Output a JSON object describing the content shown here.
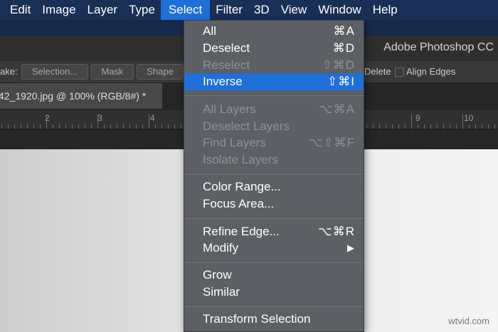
{
  "menubar": {
    "items": [
      "Edit",
      "Image",
      "Layer",
      "Type",
      "Select",
      "Filter",
      "3D",
      "View",
      "Window",
      "Help"
    ],
    "active": "Select"
  },
  "app": {
    "title": "Adobe Photoshop CC"
  },
  "options_bar": {
    "make_label": "ake:",
    "selection_button": "Selection...",
    "mask_button": "Mask",
    "shape_button": "Shape",
    "delete_label": "Delete",
    "align_edges_label": "Align Edges"
  },
  "document": {
    "tab_title": "42_1920.jpg @ 100% (RGB/8#) *"
  },
  "ruler": {
    "labels": [
      "2",
      "3",
      "4",
      "9",
      "10"
    ]
  },
  "select_menu": {
    "items": [
      {
        "label": "All",
        "shortcut": "⌘A",
        "state": "enabled"
      },
      {
        "label": "Deselect",
        "shortcut": "⌘D",
        "state": "enabled"
      },
      {
        "label": "Reselect",
        "shortcut": "⇧⌘D",
        "state": "disabled"
      },
      {
        "label": "Inverse",
        "shortcut": "⇧⌘I",
        "state": "highlighted"
      },
      {
        "label": "All Layers",
        "shortcut": "⌥⌘A",
        "state": "disabled"
      },
      {
        "label": "Deselect Layers",
        "shortcut": "",
        "state": "disabled"
      },
      {
        "label": "Find Layers",
        "shortcut": "⌥⇧⌘F",
        "state": "disabled"
      },
      {
        "label": "Isolate Layers",
        "shortcut": "",
        "state": "disabled"
      },
      {
        "label": "Color Range...",
        "shortcut": "",
        "state": "enabled"
      },
      {
        "label": "Focus Area...",
        "shortcut": "",
        "state": "enabled"
      },
      {
        "label": "Refine Edge...",
        "shortcut": "⌥⌘R",
        "state": "enabled"
      },
      {
        "label": "Modify",
        "shortcut": "▶",
        "state": "enabled"
      },
      {
        "label": "Grow",
        "shortcut": "",
        "state": "enabled"
      },
      {
        "label": "Similar",
        "shortcut": "",
        "state": "enabled"
      },
      {
        "label": "Transform Selection",
        "shortcut": "",
        "state": "enabled"
      }
    ]
  },
  "watermark": "wtvid.com",
  "colors": {
    "accent": "#1f6fd9",
    "menu_bg": "#5c5f63",
    "menubar_bg": "#1a2f55"
  }
}
